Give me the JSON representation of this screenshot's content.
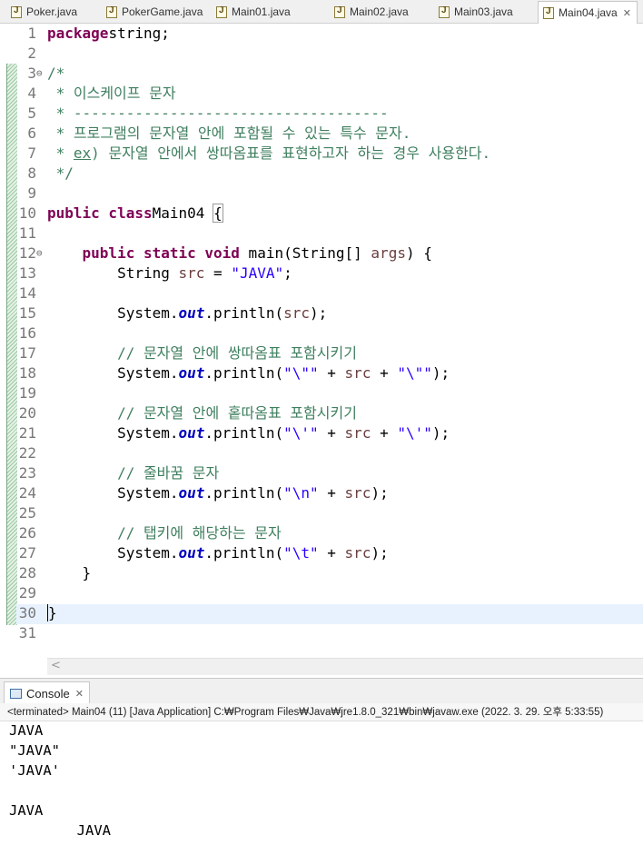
{
  "tabs": [
    {
      "label": "Poker.java"
    },
    {
      "label": "PokerGame.java"
    },
    {
      "label": "Main01.java"
    },
    {
      "label": "Main02.java"
    },
    {
      "label": "Main03.java"
    },
    {
      "label": "Main04.java",
      "active": true,
      "close": "✕"
    }
  ],
  "editor": {
    "lines": [
      {
        "n": "1",
        "code": [
          [
            "kw",
            "package"
          ],
          [
            "",
            "string;"
          ]
        ]
      },
      {
        "n": "2",
        "code": []
      },
      {
        "n": "3",
        "fold": "⊖",
        "code": [
          [
            "cm",
            "/*"
          ]
        ]
      },
      {
        "n": "4",
        "code": [
          [
            "cm",
            " * 이스케이프 문자"
          ]
        ]
      },
      {
        "n": "5",
        "code": [
          [
            "cm",
            " * ------------------------------------"
          ]
        ]
      },
      {
        "n": "6",
        "code": [
          [
            "cm",
            " * 프로그램의 문자열 안에 포함될 수 있는 특수 문자."
          ]
        ]
      },
      {
        "n": "7",
        "code": [
          [
            "cm",
            " * "
          ],
          [
            "cm ex",
            "ex"
          ],
          [
            "cm",
            ") 문자열 안에서 쌍따옴표를 표현하고자 하는 경우 사용한다."
          ]
        ]
      },
      {
        "n": "8",
        "code": [
          [
            "cm",
            " */"
          ]
        ]
      },
      {
        "n": "9",
        "code": []
      },
      {
        "n": "10",
        "code": [
          [
            "kw",
            "public class"
          ],
          [
            "",
            "Main04 "
          ],
          [
            "mark",
            "{"
          ]
        ]
      },
      {
        "n": "11",
        "code": []
      },
      {
        "n": "12",
        "fold": "⊖",
        "code": [
          [
            "",
            "    "
          ],
          [
            "kw",
            "public static void"
          ],
          [
            "",
            " main(String[] "
          ],
          [
            "var",
            "args"
          ],
          [
            "",
            ") {"
          ]
        ]
      },
      {
        "n": "13",
        "code": [
          [
            "",
            "        String "
          ],
          [
            "var",
            "src"
          ],
          [
            "",
            " = "
          ],
          [
            "str",
            "\"JAVA\""
          ],
          [
            "",
            ";"
          ]
        ]
      },
      {
        "n": "14",
        "code": []
      },
      {
        "n": "15",
        "code": [
          [
            "",
            "        System."
          ],
          [
            "fld",
            "out"
          ],
          [
            "",
            ".println("
          ],
          [
            "var",
            "src"
          ],
          [
            "",
            ");"
          ]
        ]
      },
      {
        "n": "16",
        "code": []
      },
      {
        "n": "17",
        "code": [
          [
            "",
            "        "
          ],
          [
            "cm",
            "// 문자열 안에 쌍따옴표 포함시키기"
          ]
        ]
      },
      {
        "n": "18",
        "code": [
          [
            "",
            "        System."
          ],
          [
            "fld",
            "out"
          ],
          [
            "",
            ".println("
          ],
          [
            "str",
            "\"\\\"\""
          ],
          [
            "",
            " + "
          ],
          [
            "var",
            "src"
          ],
          [
            "",
            " + "
          ],
          [
            "str",
            "\"\\\"\""
          ],
          [
            "",
            ");"
          ]
        ]
      },
      {
        "n": "19",
        "code": []
      },
      {
        "n": "20",
        "code": [
          [
            "",
            "        "
          ],
          [
            "cm",
            "// 문자열 안에 홑따옴표 포함시키기"
          ]
        ]
      },
      {
        "n": "21",
        "code": [
          [
            "",
            "        System."
          ],
          [
            "fld",
            "out"
          ],
          [
            "",
            ".println("
          ],
          [
            "str",
            "\"\\'\""
          ],
          [
            "",
            " + "
          ],
          [
            "var",
            "src"
          ],
          [
            "",
            " + "
          ],
          [
            "str",
            "\"\\'\""
          ],
          [
            "",
            ");"
          ]
        ]
      },
      {
        "n": "22",
        "code": []
      },
      {
        "n": "23",
        "code": [
          [
            "",
            "        "
          ],
          [
            "cm",
            "// 줄바꿈 문자"
          ]
        ]
      },
      {
        "n": "24",
        "code": [
          [
            "",
            "        System."
          ],
          [
            "fld",
            "out"
          ],
          [
            "",
            ".println("
          ],
          [
            "str",
            "\"\\n\""
          ],
          [
            "",
            " + "
          ],
          [
            "var",
            "src"
          ],
          [
            "",
            ");"
          ]
        ]
      },
      {
        "n": "25",
        "code": []
      },
      {
        "n": "26",
        "code": [
          [
            "",
            "        "
          ],
          [
            "cm",
            "// 탭키에 해당하는 문자"
          ]
        ]
      },
      {
        "n": "27",
        "code": [
          [
            "",
            "        System."
          ],
          [
            "fld",
            "out"
          ],
          [
            "",
            ".println("
          ],
          [
            "str",
            "\"\\t\""
          ],
          [
            "",
            " + "
          ],
          [
            "var",
            "src"
          ],
          [
            "",
            ");"
          ]
        ]
      },
      {
        "n": "28",
        "code": [
          [
            "",
            "    }"
          ]
        ]
      },
      {
        "n": "29",
        "code": []
      },
      {
        "n": "30",
        "code": [
          [
            "caret",
            "}"
          ]
        ]
      },
      {
        "n": "31",
        "code": []
      }
    ],
    "scroll_left": "<"
  },
  "console": {
    "tab_label": "Console",
    "close": "✕",
    "status": "<terminated> Main04 (11) [Java Application] C:₩Program Files₩Java₩jre1.8.0_321₩bin₩javaw.exe (2022. 3. 29. 오후 5:33:55)",
    "output": [
      "JAVA",
      "\"JAVA\"",
      "'JAVA'",
      "",
      "JAVA",
      "        JAVA"
    ]
  }
}
